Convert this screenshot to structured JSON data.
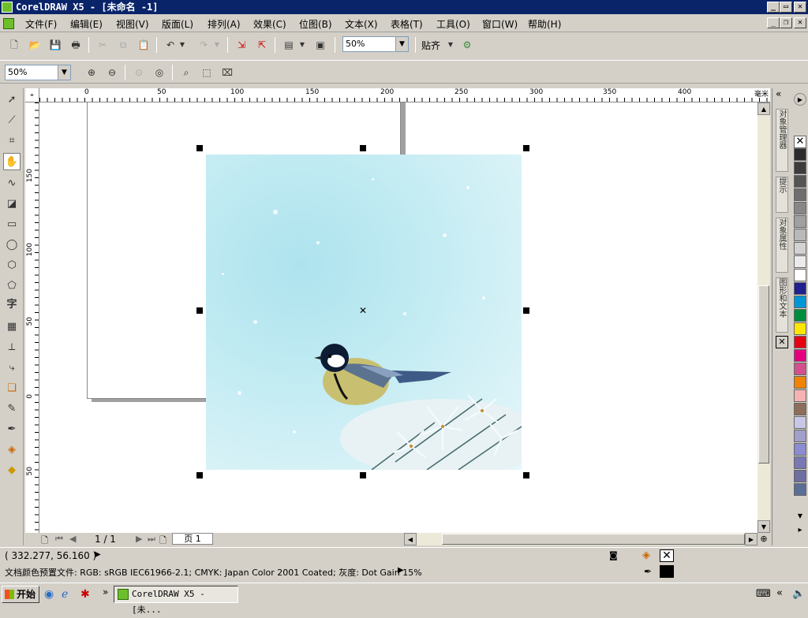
{
  "window": {
    "title": "CorelDRAW X5 - [未命名 -1]"
  },
  "menu": [
    "文件(F)",
    "编辑(E)",
    "视图(V)",
    "版面(L)",
    "排列(A)",
    "效果(C)",
    "位图(B)",
    "文本(X)",
    "表格(T)",
    "工具(O)",
    "窗口(W)",
    "帮助(H)"
  ],
  "toolbar": {
    "zoom_value": "50%",
    "snap_label": "贴齐"
  },
  "zoombar": {
    "zoom_value": "50%"
  },
  "ruler": {
    "h_ticks": [
      "0",
      "50",
      "100",
      "150",
      "200",
      "250",
      "300",
      "350",
      "400"
    ],
    "h_unit": "毫米",
    "v_ticks": [
      "150",
      "100",
      "50",
      "0",
      "50"
    ]
  },
  "pagebar": {
    "page_count": "1 / 1",
    "page_tab": "页 1"
  },
  "docker": {
    "tabs": [
      "对象管理器",
      "提示",
      "对象属性",
      "图形和文本"
    ]
  },
  "palette": {
    "colors": [
      "#2b2b2b",
      "#3c3c3c",
      "#555555",
      "#6e6e6e",
      "#878787",
      "#a0a0a0",
      "#b9b9b9",
      "#d2d2d2",
      "#ebebeb",
      "#ffffff",
      "#1f1f8f",
      "#0096d6",
      "#008c3a",
      "#ffe600",
      "#e60012",
      "#e4007f",
      "#d2508c",
      "#f08300",
      "#f5b2b2",
      "#8c6e5a",
      "#c8c8e6",
      "#a0a0c8",
      "#8c8cd2",
      "#7878b4",
      "#6e6ea0",
      "#5a6e96"
    ]
  },
  "status": {
    "coords": "( 332.277, 56.160 )",
    "profile": "文档颜色预置文件: RGB: sRGB IEC61966-2.1; CMYK: Japan Color 2001 Coated; 灰度: Dot Gain 15%"
  },
  "taskbar": {
    "start": "开始",
    "task": "CorelDRAW X5 - [未..."
  }
}
